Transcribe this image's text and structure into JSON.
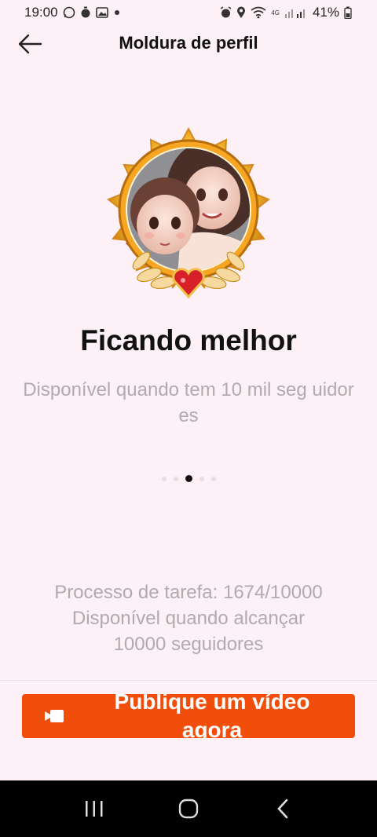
{
  "status_bar": {
    "time": "19:00",
    "battery": "41%",
    "left_icons": [
      "whatsapp-icon",
      "timer-icon",
      "image-icon",
      "dot-icon"
    ],
    "right_icons": [
      "alarm-icon",
      "location-icon",
      "wifi-icon",
      "signal-icon",
      "battery-icon"
    ],
    "network_label": "4G"
  },
  "header": {
    "title": "Moldura de perfil",
    "back_icon": "arrow-left-icon"
  },
  "frame": {
    "name": "Ficando melhor",
    "description": "Disponível quando tem 10 mil seg uidores",
    "image_icon": "profile-frame-image"
  },
  "pagination": {
    "count": 5,
    "active_index": 2
  },
  "progress": {
    "line1": "Processo de tarefa: 1674/10000",
    "line2": "Disponível quando alcançar",
    "line3": "10000 seguidores",
    "current": 1674,
    "target": 10000
  },
  "action": {
    "label": "Publique um vídeo agora",
    "icon": "video-camera-icon",
    "color": "#f24e0b"
  },
  "nav": {
    "recents": "recents-icon",
    "home": "home-icon",
    "back": "back-icon"
  },
  "colors": {
    "background": "#fdf0f6",
    "muted_text": "#b3a9ae",
    "accent": "#f24e0b"
  }
}
